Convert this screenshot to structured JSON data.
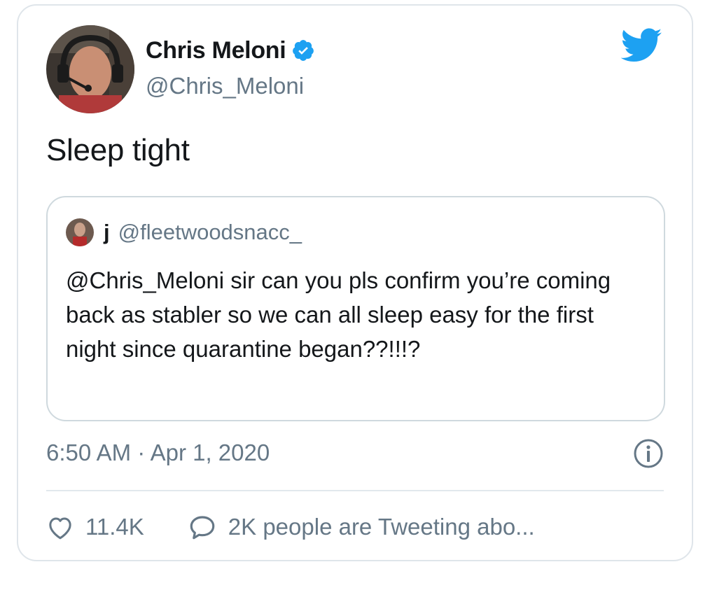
{
  "author": {
    "display_name": "Chris Meloni",
    "handle": "@Chris_Meloni",
    "verified_icon": "verified-badge-icon",
    "avatar_icon": "profile-photo"
  },
  "tweet": {
    "text": "Sleep tight",
    "timestamp": "6:50 AM · Apr 1, 2020"
  },
  "quoted_tweet": {
    "display_name": "j",
    "handle": "@fleetwoodsnacc_",
    "text": "@Chris_Meloni sir can you pls confirm you’re coming back as stabler so we can all sleep easy for the first night since quarantine began??!!!?"
  },
  "actions": {
    "likes_count": "11.4K",
    "tweeting_about": "2K people are Tweeting abo..."
  },
  "colors": {
    "twitter_blue": "#1DA1F2",
    "secondary_text": "#657786",
    "border": "#dfe5ea"
  }
}
